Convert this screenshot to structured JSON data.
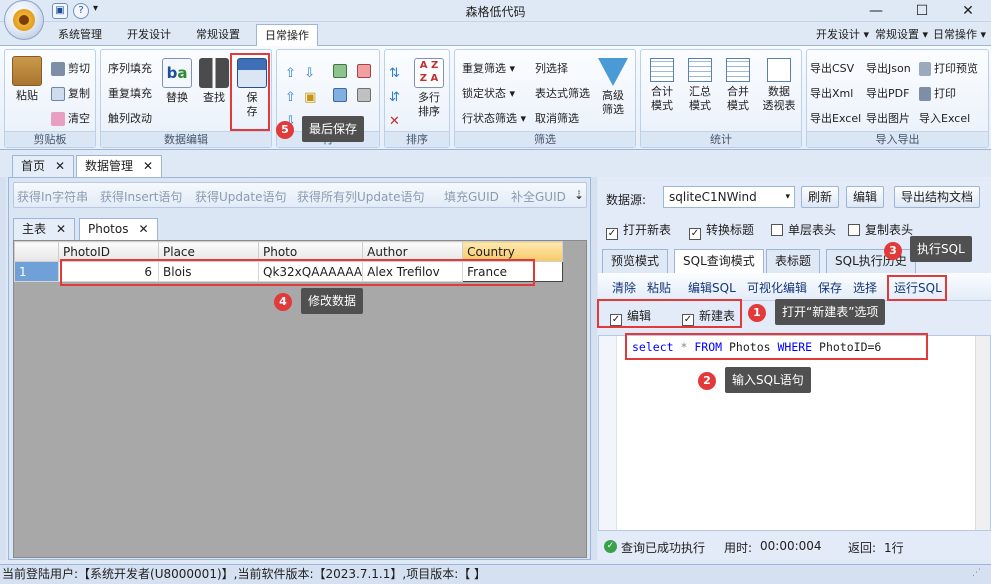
{
  "window": {
    "title": "森格低代码",
    "minimize": "—",
    "maximize": "☐",
    "close": "✕"
  },
  "menu": {
    "tabs": [
      "系统管理",
      "开发设计",
      "常规设置",
      "日常操作"
    ],
    "right": [
      "开发设计 ▾",
      "常规设置 ▾",
      "日常操作 ▾"
    ]
  },
  "ribbon": {
    "clipboard": {
      "paste": "粘贴",
      "cut": "剪切",
      "copy": "复制",
      "clear": "清空",
      "label": "剪贴板"
    },
    "dataedit": {
      "fill_seq": "序列填充",
      "fill_repeat": "重复填充",
      "trigger": "触列改动",
      "replace": "替换",
      "find": "查找",
      "save1": "保",
      "save2": "存",
      "label": "数据编辑"
    },
    "row": {
      "label": "行"
    },
    "sort": {
      "multi1": "多行",
      "multi2": "排序",
      "label": "排序"
    },
    "filter": {
      "repeat": "重复筛选 ▾",
      "column": "列选择",
      "lock": "锁定状态 ▾",
      "expr": "表达式筛选",
      "rowstate": "行状态筛选 ▾",
      "cancel": "取消筛选",
      "adv1": "高级",
      "adv2": "筛选",
      "label": "筛选"
    },
    "stats": {
      "total1": "合计",
      "total2": "模式",
      "sum1": "汇总",
      "sum2": "模式",
      "merge1": "合并",
      "merge2": "模式",
      "pivot1": "数据",
      "pivot2": "透视表",
      "label": "统计"
    },
    "export": {
      "csv": "导出CSV",
      "json": "导出Json",
      "preview": "打印预览",
      "xml": "导出Xml",
      "pdf": "导出PDF",
      "print": "打印",
      "excel": "导出Excel",
      "image": "导出图片",
      "import": "导入Excel",
      "label": "导入导出"
    }
  },
  "doctabs": [
    {
      "label": "首页"
    },
    {
      "label": "数据管理"
    }
  ],
  "toolbar": {
    "items": [
      "获得In字符串",
      "获得Insert语句",
      "获得Update语句",
      "获得所有列Update语句",
      "填充GUID",
      "补全GUID"
    ],
    "more": "⇣"
  },
  "subtabs": [
    {
      "label": "主表"
    },
    {
      "label": "Photos"
    }
  ],
  "grid": {
    "columns": [
      "PhotoID",
      "Place",
      "Photo",
      "Author",
      "Country"
    ],
    "rows": [
      {
        "num": "1",
        "PhotoID": "6",
        "Place": "Blois",
        "Photo": "Qk32xQAAAAAA",
        "Author": "Alex Trefilov",
        "Country": "France"
      }
    ]
  },
  "right": {
    "datasource_label": "数据源:",
    "datasource_value": "sqliteC1NWind",
    "refresh": "刷新",
    "edit": "编辑",
    "export_doc": "导出结构文档",
    "checks": [
      {
        "label": "打开新表",
        "checked": true
      },
      {
        "label": "转换标题",
        "checked": true
      },
      {
        "label": "单层表头",
        "checked": false
      },
      {
        "label": "复制表头",
        "checked": false
      }
    ],
    "tabs": [
      "预览模式",
      "SQL查询模式",
      "表标题",
      "SQL执行历史"
    ],
    "sqltools": [
      "清除",
      "粘贴",
      "编辑SQL",
      "可视化编辑",
      "保存",
      "选择",
      "运行SQL"
    ],
    "options": [
      {
        "label": "编辑",
        "checked": true
      },
      {
        "label": "新建表",
        "checked": true
      }
    ],
    "sql": {
      "k1": "select",
      "star": "*",
      "k2": "FROM",
      "table": "Photos",
      "k3": "WHERE",
      "cond": "PhotoID=6"
    },
    "status": {
      "msg": "查询已成功执行",
      "time_label": "用时:",
      "time": "00:00:004",
      "rows_label": "返回:",
      "rows": "1行"
    }
  },
  "statusbar": "当前登陆用户:【系统开发者(U8000001)】,当前软件版本:【2023.7.1.1】,项目版本:【 】",
  "annotations": [
    {
      "num": "1",
      "text": "打开“新建表”选项"
    },
    {
      "num": "2",
      "text": "输入SQL语句"
    },
    {
      "num": "3",
      "text": "执行SQL"
    },
    {
      "num": "4",
      "text": "修改数据"
    },
    {
      "num": "5",
      "text": "最后保存"
    }
  ],
  "colors": {
    "accent": "#e23a3a",
    "ribbon": "#dfe9f5",
    "sql_keyword": "#0000ff"
  }
}
